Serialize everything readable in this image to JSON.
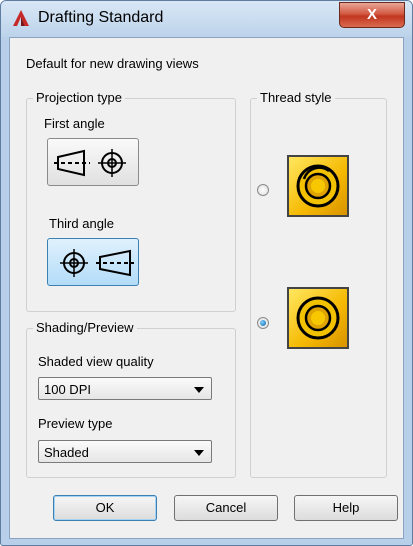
{
  "window": {
    "title": "Drafting Standard",
    "close_label": "X"
  },
  "header": {
    "text": "Default for new drawing views"
  },
  "projection": {
    "group_title": "Projection type",
    "first_angle_label": "First angle",
    "third_angle_label": "Third angle",
    "selected": "Third angle"
  },
  "thread": {
    "group_title": "Thread style",
    "options": [
      "thread-style-1",
      "thread-style-2"
    ],
    "selected_index": 1
  },
  "shading": {
    "group_title": "Shading/Preview",
    "quality_label": "Shaded view quality",
    "quality_value": "100 DPI",
    "preview_label": "Preview type",
    "preview_value": "Shaded"
  },
  "buttons": {
    "ok": "OK",
    "cancel": "Cancel",
    "help": "Help"
  },
  "colors": {
    "accent": "#3c7fb1",
    "close": "#c2361f",
    "thread_fill": "#f5b800"
  }
}
